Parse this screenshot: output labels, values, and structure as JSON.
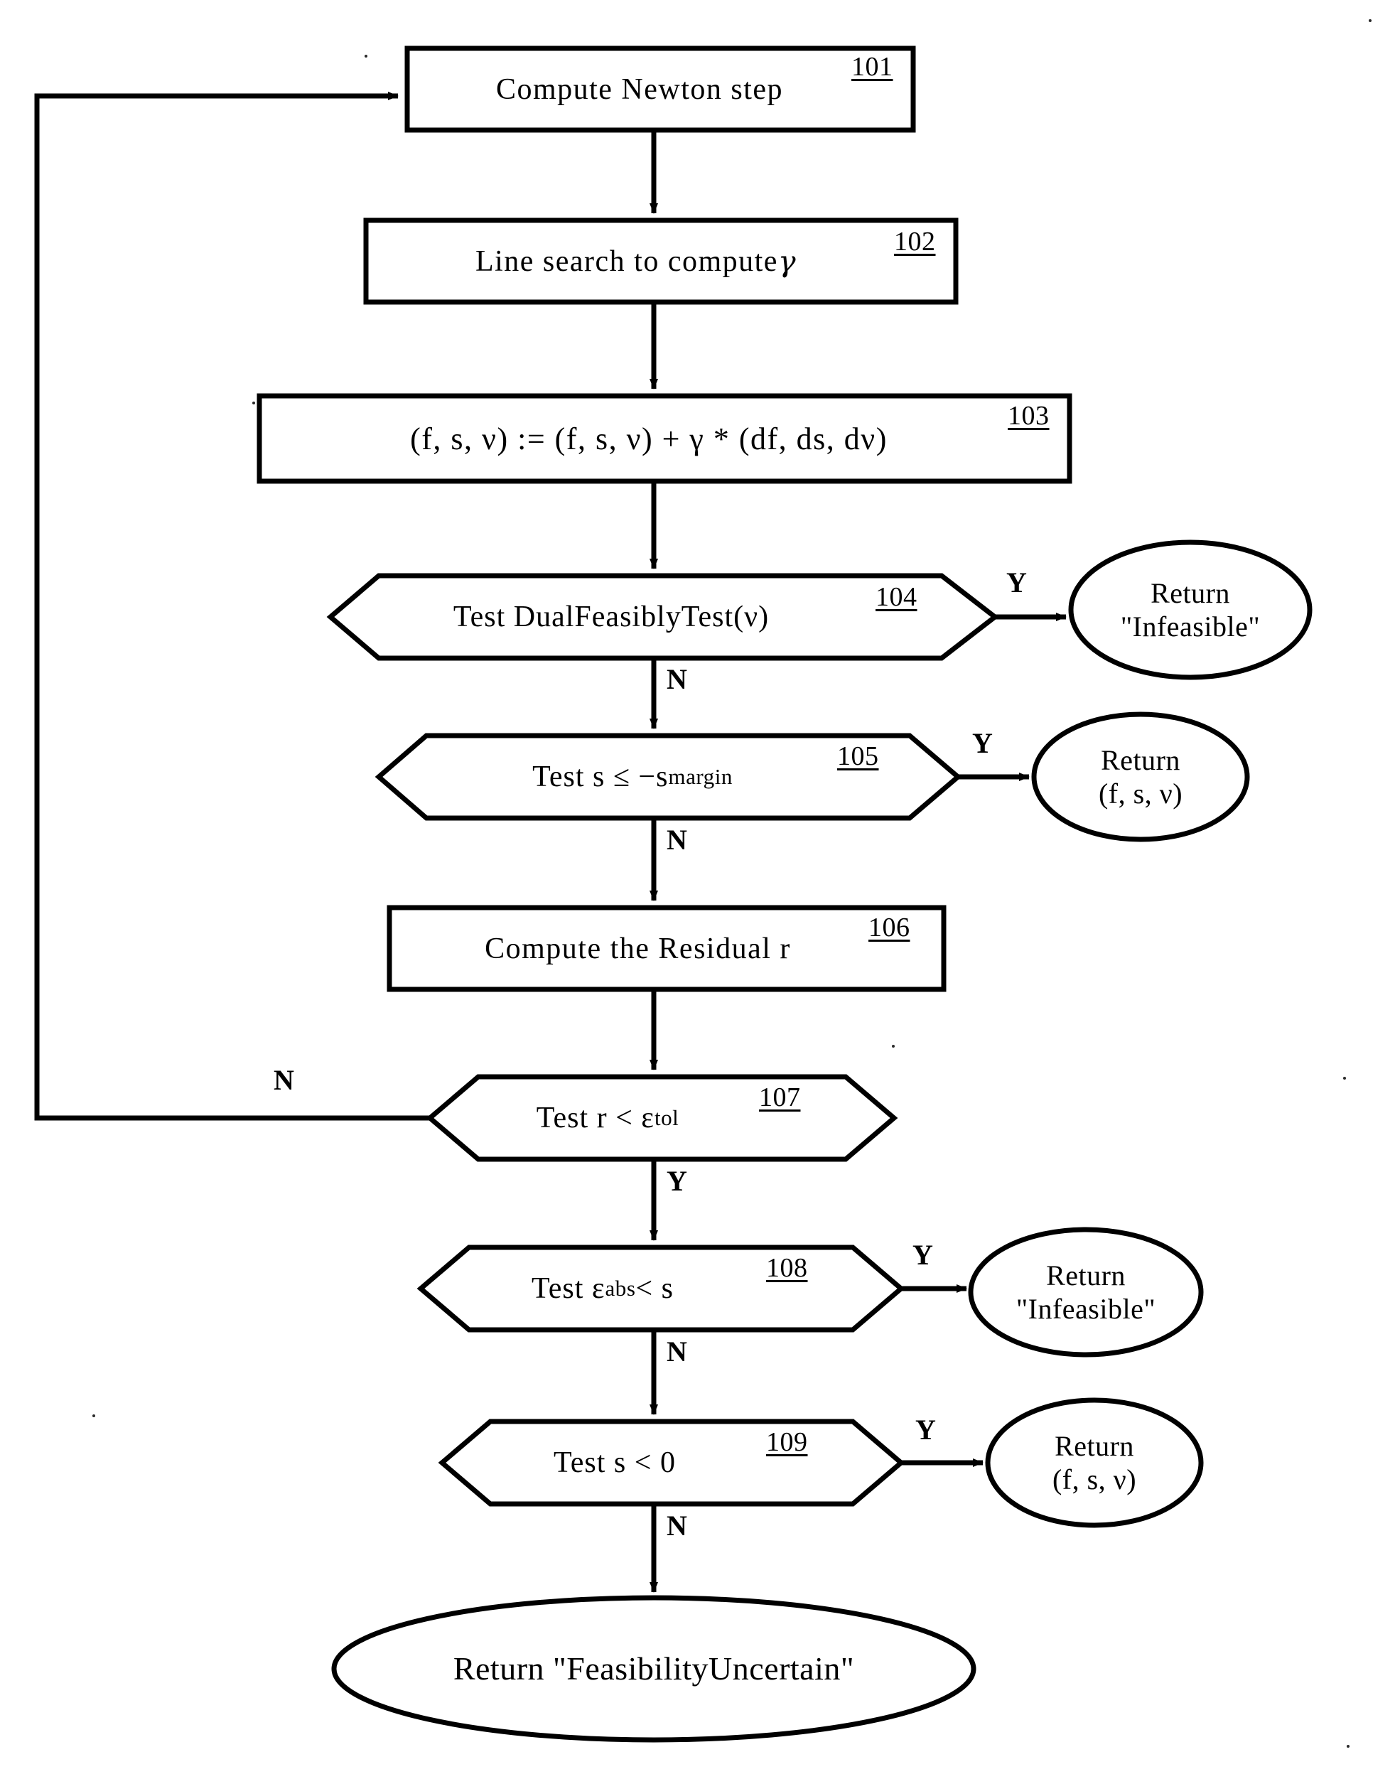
{
  "figure": {
    "type": "flowchart",
    "title": "Newton step feasibility iteration flowchart",
    "background_color": "#ffffff",
    "line_color": "#000000"
  },
  "nodes": [
    {
      "id": "101",
      "shape": "process",
      "ref": "101",
      "text": "Compute Newton step"
    },
    {
      "id": "102",
      "shape": "process",
      "ref": "102",
      "text_pre": "Line search to compute ",
      "text_sym": "γ",
      "text": "Line search to compute γ"
    },
    {
      "id": "103",
      "shape": "process",
      "ref": "103",
      "text": "(f, s, ν) := (f, s, ν) + γ * (df, ds, dν)"
    },
    {
      "id": "104",
      "shape": "decision",
      "ref": "104",
      "text": "Test DualFeasiblyTest(ν)"
    },
    {
      "id": "105",
      "shape": "decision",
      "ref": "105",
      "text_main": "Test s ≤ −s",
      "text_sub": "margin",
      "text": "Test s ≤ −s margin"
    },
    {
      "id": "106",
      "shape": "process",
      "ref": "106",
      "text": "Compute the Residual r"
    },
    {
      "id": "107",
      "shape": "decision",
      "ref": "107",
      "text_main": "Test r < ε",
      "text_sub": "tol",
      "text": "Test r < ε tol"
    },
    {
      "id": "108",
      "shape": "decision",
      "ref": "108",
      "text_main": "Test ε",
      "text_sub": "abs",
      "text_post": "< s",
      "text": "Test ε abs < s"
    },
    {
      "id": "109",
      "shape": "decision",
      "ref": "109",
      "text": "Test s < 0"
    },
    {
      "id": "t104",
      "shape": "terminator",
      "line1": "Return",
      "line2": "\"Infeasible\""
    },
    {
      "id": "t105",
      "shape": "terminator",
      "line1": "Return",
      "line2": "(f, s, ν)"
    },
    {
      "id": "t108",
      "shape": "terminator",
      "line1": "Return",
      "line2": "\"Infeasible\""
    },
    {
      "id": "t109",
      "shape": "terminator",
      "line1": "Return",
      "line2": "(f, s, ν)"
    },
    {
      "id": "t_end",
      "shape": "terminator",
      "line1": "Return \"FeasibilityUncertain\"",
      "line2": ""
    }
  ],
  "edge_labels": {
    "e104_yes": "Y",
    "e104_no": "N",
    "e105_yes": "Y",
    "e105_no": "N",
    "e107_no": "N",
    "e107_yes": "Y",
    "e108_yes": "Y",
    "e108_no": "N",
    "e109_yes": "Y",
    "e109_no": "N"
  }
}
